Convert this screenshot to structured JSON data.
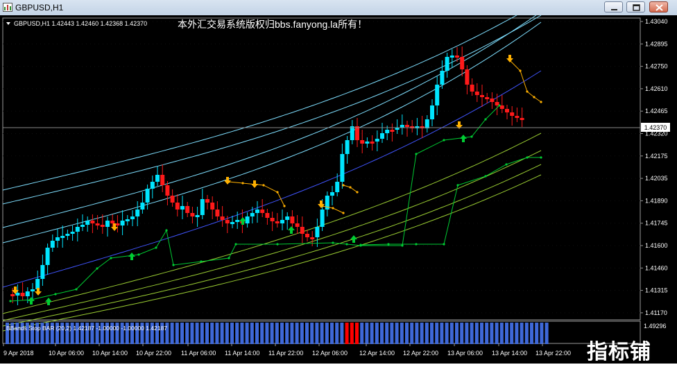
{
  "window": {
    "title": "GBPUSD,H1",
    "buttons": {
      "minimize": "minimize",
      "maximize": "maximize",
      "close": "close"
    }
  },
  "chart": {
    "info_line": "GBPUSD,H1  1.42443 1.42460 1.42368 1.42370",
    "overlay_text": "本外汇交易系统版权归bbs.fanyong.la所有！",
    "current_price": "1.42370",
    "price_labels": [
      "1.43040",
      "1.42895",
      "1.42750",
      "1.42610",
      "1.42465",
      "1.42320",
      "1.42175",
      "1.42035",
      "1.41890",
      "1.41745",
      "1.41600",
      "1.41460",
      "1.41315",
      "1.41170"
    ],
    "time_labels": [
      "9 Apr 2018",
      "10 Apr 06:00",
      "10 Apr 14:00",
      "10 Apr 22:00",
      "11 Apr 06:00",
      "11 Apr 14:00",
      "11 Apr 22:00",
      "12 Apr 06:00",
      "12 Apr 14:00",
      "12 Apr 22:00",
      "13 Apr 06:00",
      "13 Apr 14:00",
      "13 Apr 22:00"
    ],
    "indicator": {
      "label": "BBands Stop BAR (20,2) 1.42187 -1.00000 -1.00000 1.42187",
      "scale_value": "1.49296",
      "up_color": "#3e68d8",
      "down_color": "#ff0000"
    },
    "colors": {
      "background": "#000000",
      "bull": "#00e5ff",
      "bear": "#ff1a1a",
      "upper_bands": "#7fdfff",
      "mid_line": "#4055ff",
      "lower_bands": "#9acd32",
      "stop_up": "#00cc33",
      "stop_down": "#ffb000"
    }
  },
  "site_watermark": "指标铺"
}
